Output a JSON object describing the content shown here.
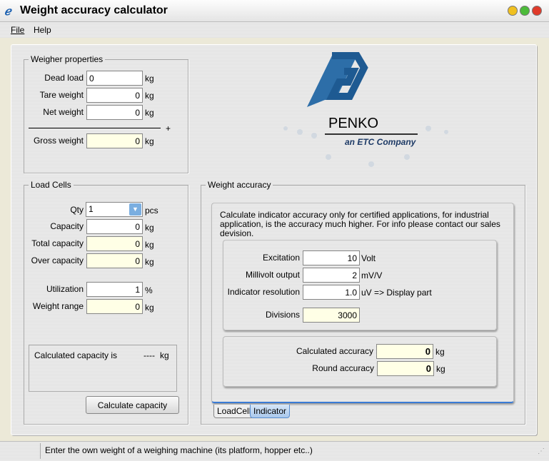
{
  "window": {
    "title": "Weight accuracy calculator"
  },
  "menu": {
    "file": "File",
    "help": "Help"
  },
  "weigher": {
    "legend": "Weigher properties",
    "dead_load_label": "Dead load",
    "dead_load": "0",
    "tare_label": "Tare weight",
    "tare": "0",
    "net_label": "Net weight",
    "net": "0",
    "plus": "+",
    "gross_label": "Gross weight",
    "gross": "0",
    "unit": "kg"
  },
  "logo": {
    "brand": "PENKO",
    "tagline": "an ETC Company"
  },
  "loadcells": {
    "legend": "Load Cells",
    "qty_label": "Qty",
    "qty": "1",
    "qty_unit": "pcs",
    "capacity_label": "Capacity",
    "capacity": "0",
    "total_label": "Total capacity",
    "total": "0",
    "over_label": "Over capacity",
    "over": "0",
    "util_label": "Utilization",
    "util": "1",
    "util_unit": "%",
    "range_label": "Weight range",
    "range": "0",
    "unit": "kg",
    "calc_text": "Calculated capacity is",
    "calc_value": "----",
    "calc_unit": "kg",
    "button": "Calculate capacity"
  },
  "accuracy": {
    "legend": "Weight accuracy",
    "info": "Calculate indicator accuracy only for certified applications, for industrial application, is the accuracy  much higher. For info please contact our sales devision.",
    "excitation_label": "Excitation",
    "excitation": "10",
    "excitation_unit": "Volt",
    "mv_label": "Millivolt output",
    "mv": "2",
    "mv_unit": "mV/V",
    "res_label": "Indicator resolution",
    "res": "1.0",
    "res_unit": "uV => Display part",
    "div_label": "Divisions",
    "div": "3000",
    "calc_label": "Calculated accuracy",
    "calc": "0",
    "round_label": "Round accuracy",
    "round": "0",
    "unit": "kg",
    "tabs": [
      "LoadCell",
      "Indicator"
    ]
  },
  "status": {
    "text": "Enter the own weight of a weighing machine (its platform, hopper etc..)"
  }
}
